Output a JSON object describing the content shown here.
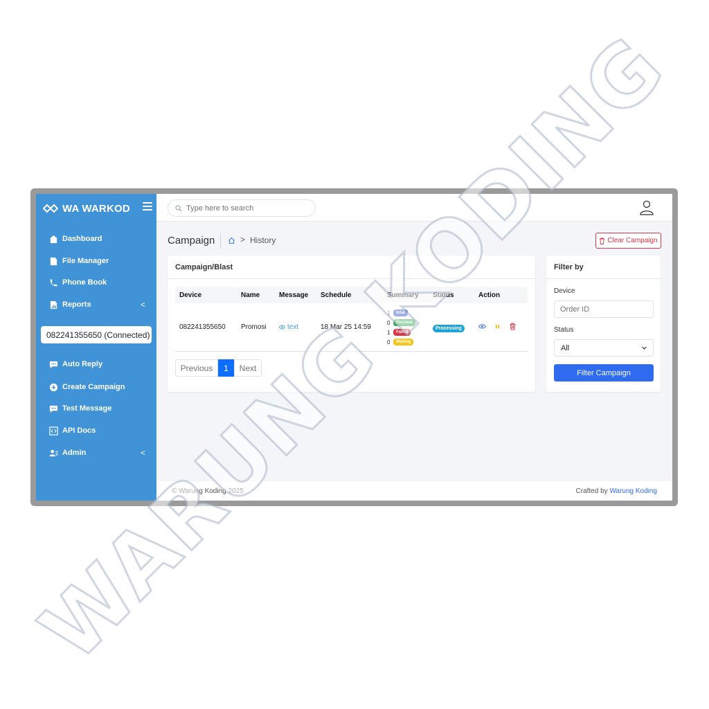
{
  "brand": {
    "name": "WA WARKOD"
  },
  "sidebar": {
    "items": [
      {
        "label": "Dashboard",
        "icon": "home-icon"
      },
      {
        "label": "File Manager",
        "icon": "file-icon"
      },
      {
        "label": "Phone Book",
        "icon": "phone-icon"
      },
      {
        "label": "Reports",
        "icon": "report-icon",
        "chevron": "<"
      },
      {
        "label": "Auto Reply",
        "icon": "chat-icon"
      },
      {
        "label": "Create Campaign",
        "icon": "plus-circle-icon"
      },
      {
        "label": "Test Message",
        "icon": "chat-icon"
      },
      {
        "label": "API Docs",
        "icon": "code-icon"
      },
      {
        "label": "Admin",
        "icon": "users-icon",
        "chevron": "<"
      }
    ],
    "device": "082241355650 (Connected)"
  },
  "search": {
    "placeholder": "Type here to search"
  },
  "header": {
    "title": "Campaign",
    "breadcrumb": "History",
    "clear_button": "Clear Campaign"
  },
  "campaign_card": {
    "title": "Campaign/Blast",
    "columns": [
      "Device",
      "Name",
      "Message",
      "Schedule",
      "Summary",
      "Status",
      "Action"
    ],
    "row": {
      "device": "082241355650",
      "name": "Promosi",
      "message": "text",
      "schedule": "18 Mar 25 14:59",
      "summary": [
        {
          "count": "1",
          "label": "total"
        },
        {
          "count": "0",
          "label": "Success"
        },
        {
          "count": "1",
          "label": "Failed"
        },
        {
          "count": "0",
          "label": "Waiting"
        }
      ],
      "status": "Processing"
    },
    "pagination": {
      "prev": "Previous",
      "page": "1",
      "next": "Next"
    }
  },
  "filter": {
    "title": "Filter by",
    "device_label": "Device",
    "device_placeholder": "Order ID",
    "status_label": "Status",
    "status_value": "All",
    "button": "Filter Campaign"
  },
  "footer": {
    "copyright": "© Warung Koding 2025",
    "crafted_prefix": "Crafted by",
    "crafted_link": "Warung Koding"
  },
  "watermark": "WARUNG KODING",
  "colors": {
    "sidebar": "#4193d8",
    "primary": "#2f6bef",
    "danger": "#dc3545",
    "success": "#28a745",
    "warning": "#f5c518",
    "info": "#1ea4d8"
  }
}
